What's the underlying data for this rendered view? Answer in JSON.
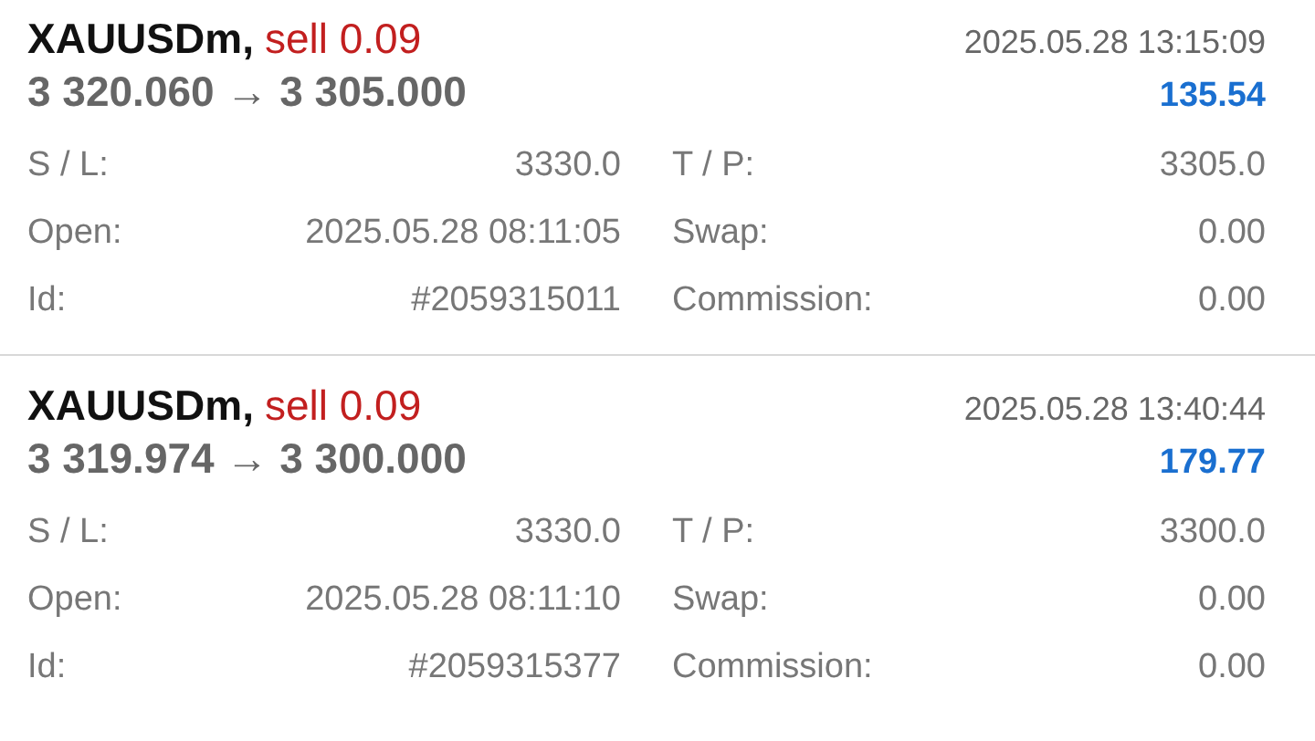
{
  "trades": [
    {
      "symbol": "XAUUSDm,",
      "side": "sell",
      "volume": "0.09",
      "time": "2025.05.28 13:15:09",
      "prices": "3 320.060 → 3 305.000",
      "profit": "135.54",
      "rows": [
        [
          {
            "label": "S / L:",
            "value": "3330.0"
          },
          {
            "label": "T / P:",
            "value": "3305.0"
          }
        ],
        [
          {
            "label": "Open:",
            "value": "2025.05.28 08:11:05"
          },
          {
            "label": "Swap:",
            "value": "0.00"
          }
        ],
        [
          {
            "label": "Id:",
            "value": "#2059315011"
          },
          {
            "label": "Commission:",
            "value": "0.00"
          }
        ]
      ]
    },
    {
      "symbol": "XAUUSDm,",
      "side": "sell",
      "volume": "0.09",
      "time": "2025.05.28 13:40:44",
      "prices": "3 319.974 → 3 300.000",
      "profit": "179.77",
      "rows": [
        [
          {
            "label": "S / L:",
            "value": "3330.0"
          },
          {
            "label": "T / P:",
            "value": "3300.0"
          }
        ],
        [
          {
            "label": "Open:",
            "value": "2025.05.28 08:11:10"
          },
          {
            "label": "Swap:",
            "value": "0.00"
          }
        ],
        [
          {
            "label": "Id:",
            "value": "#2059315377"
          },
          {
            "label": "Commission:",
            "value": "0.00"
          }
        ]
      ]
    }
  ]
}
